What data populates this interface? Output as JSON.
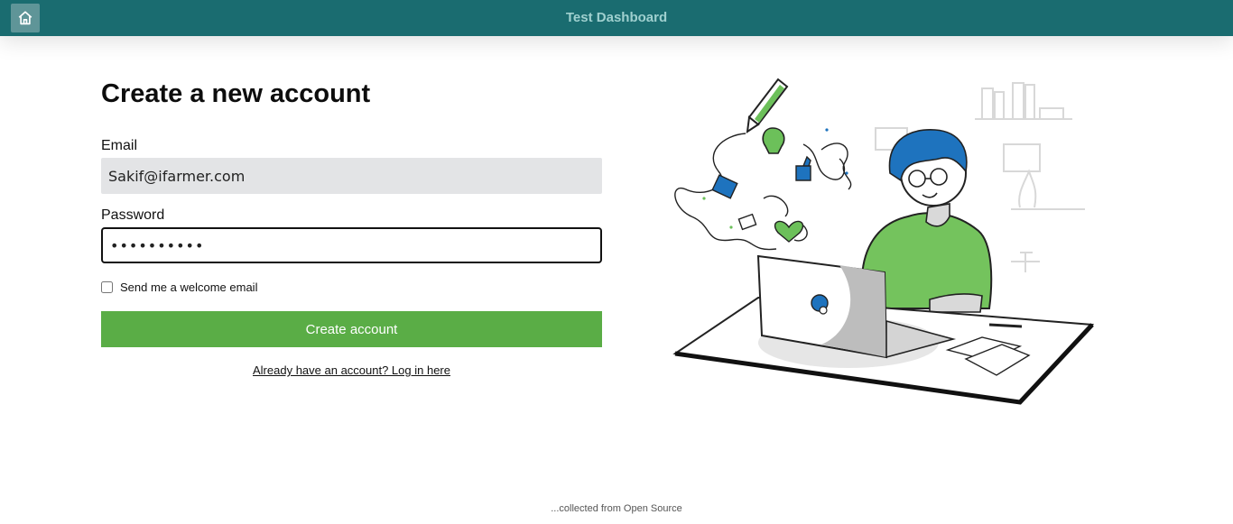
{
  "header": {
    "title": "Test Dashboard",
    "home_icon": "home-icon",
    "color": "#1a6c70"
  },
  "form": {
    "heading": "Create a new account",
    "email_label": "Email",
    "email_value": "Sakif@ifarmer.com",
    "password_label": "Password",
    "password_value": "••••••••••",
    "checkbox_label": "Send me a welcome email",
    "checkbox_checked": false,
    "submit_label": "Create account",
    "submit_color": "#5aad46",
    "login_link": "Already have an account? Log in here"
  },
  "footer": {
    "text": "...collected from Open Source"
  }
}
